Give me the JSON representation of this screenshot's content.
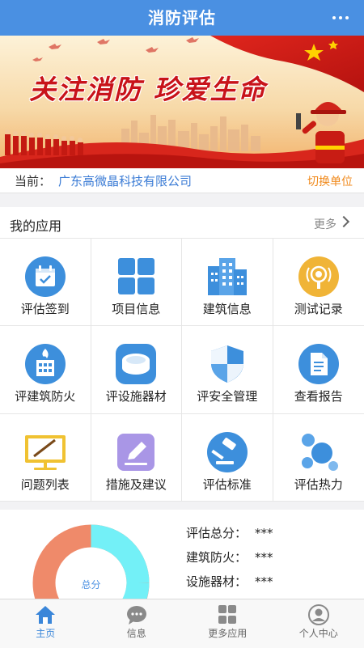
{
  "app_title": "消防评估",
  "banner": {
    "slogan": "关注消防  珍爱生命"
  },
  "unit": {
    "label": "当前：",
    "company": "广东高微晶科技有限公司",
    "switch_label": "切换单位"
  },
  "apps": {
    "section_title": "我的应用",
    "more_label": "更多",
    "items": [
      {
        "label": "评估签到",
        "icon": "calendar-check-icon"
      },
      {
        "label": "项目信息",
        "icon": "grid-icon"
      },
      {
        "label": "建筑信息",
        "icon": "building-icon"
      },
      {
        "label": "测试记录",
        "icon": "radio-icon"
      },
      {
        "label": "评建筑防火",
        "icon": "building-fire-icon"
      },
      {
        "label": "评设施器材",
        "icon": "smoke-detector-icon"
      },
      {
        "label": "评安全管理",
        "icon": "shield-icon"
      },
      {
        "label": "查看报告",
        "icon": "report-icon"
      },
      {
        "label": "问题列表",
        "icon": "easel-icon"
      },
      {
        "label": "措施及建议",
        "icon": "edit-icon"
      },
      {
        "label": "评估标准",
        "icon": "gavel-icon"
      },
      {
        "label": "评估热力",
        "icon": "bubbles-icon"
      }
    ]
  },
  "score": {
    "donut_label": "总分",
    "rows": [
      {
        "label": "评估总分：",
        "value": "***"
      },
      {
        "label": "建筑防火：",
        "value": "***"
      },
      {
        "label": "设施器材：",
        "value": "***"
      }
    ]
  },
  "tabbar": [
    {
      "label": "主页",
      "icon": "home-icon",
      "active": true
    },
    {
      "label": "信息",
      "icon": "message-icon",
      "active": false
    },
    {
      "label": "更多应用",
      "icon": "apps-icon",
      "active": false
    },
    {
      "label": "个人中心",
      "icon": "user-icon",
      "active": false
    }
  ],
  "colors": {
    "primary": "#4a90e2",
    "accent_orange": "#f08a1c",
    "link_blue": "#3a7bd5",
    "donut_salmon": "#ef8a6a",
    "donut_cyan": "#73f0f7",
    "donut_green": "#8fe07a"
  }
}
